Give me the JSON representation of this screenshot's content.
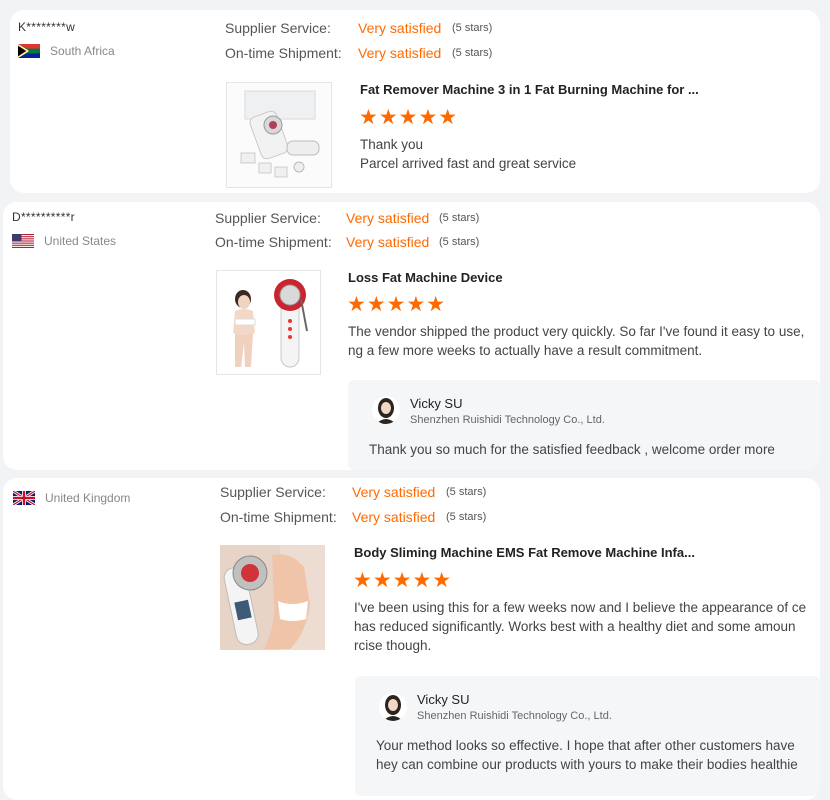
{
  "reviews": [
    {
      "buyer": "K********w",
      "country": "South Africa",
      "flag_icon": "south-africa-flag-icon",
      "supplier_service_label": "Supplier Service:",
      "supplier_service_value": "Very satisfied",
      "supplier_service_stars": "(5 stars)",
      "shipment_label": "On-time Shipment:",
      "shipment_value": "Very satisfied",
      "shipment_stars": "(5 stars)",
      "product_title": "Fat Remover Machine 3 in 1 Fat Burning Machine for ...",
      "product_image_icon": "fat-remover-machine-kit-image",
      "stars": "★★★★★",
      "rating": 5,
      "review_text": "Thank you\nParcel arrived fast and great service"
    },
    {
      "buyer": "D**********r",
      "country": "United States",
      "flag_icon": "united-states-flag-icon",
      "supplier_service_label": "Supplier Service:",
      "supplier_service_value": "Very satisfied",
      "supplier_service_stars": "(5 stars)",
      "shipment_label": "On-time Shipment:",
      "shipment_value": "Very satisfied",
      "shipment_stars": "(5 stars)",
      "product_title": "Loss Fat Machine Device",
      "product_image_icon": "loss-fat-machine-image",
      "stars": "★★★★★",
      "rating": 5,
      "review_text": "The vendor shipped the product very quickly. So far I've found it easy to use,\nng a few more weeks to actually have a result commitment.",
      "reply": {
        "name": "Vicky SU",
        "company": "Shenzhen Ruishidi Technology Co., Ltd.",
        "text": "Thank you so much for the satisfied feedback , welcome order more"
      }
    },
    {
      "buyer": "",
      "country": "United Kingdom",
      "flag_icon": "united-kingdom-flag-icon",
      "supplier_service_label": "Supplier Service:",
      "supplier_service_value": "Very satisfied",
      "supplier_service_stars": "(5 stars)",
      "shipment_label": "On-time Shipment:",
      "shipment_value": "Very satisfied",
      "shipment_stars": "(5 stars)",
      "product_title": "Body Sliming Machine EMS Fat Remove Machine Infa...",
      "product_image_icon": "body-slimming-machine-image",
      "stars": "★★★★★",
      "rating": 5,
      "review_text": "I've been using this for a few weeks now and I believe the appearance of ce\nhas reduced significantly. Works best with a healthy diet and some amoun\nrcise though.",
      "reply": {
        "name": "Vicky SU",
        "company": "Shenzhen Ruishidi Technology Co., Ltd.",
        "text": "Your method looks so effective. I hope that after other customers have\nhey can combine our products with yours to make their bodies healthie"
      }
    }
  ]
}
